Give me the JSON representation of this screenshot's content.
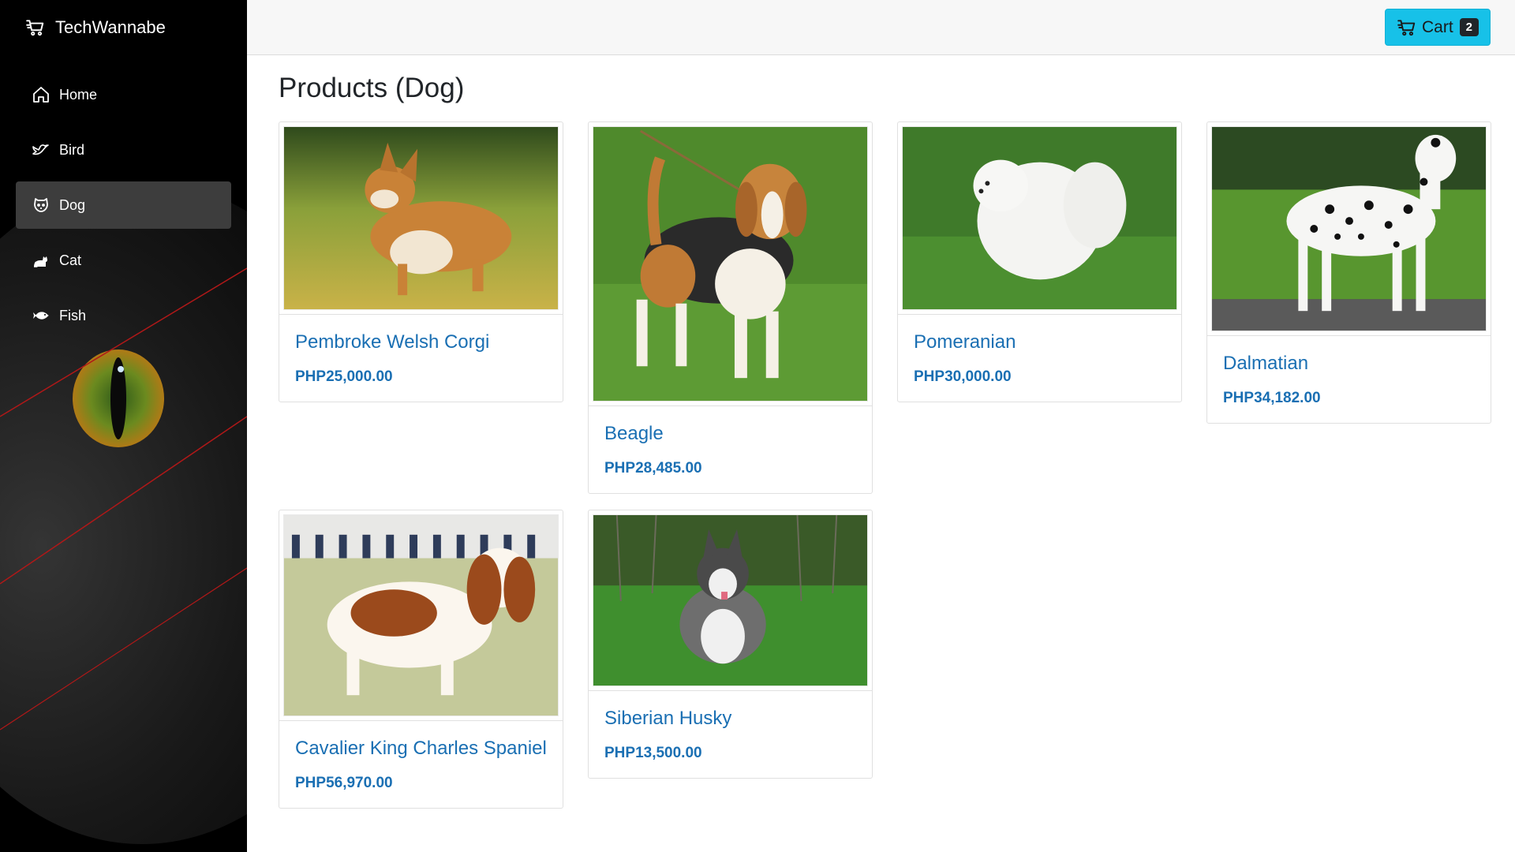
{
  "app": {
    "brand": "TechWannabe"
  },
  "sidebar": {
    "items": [
      {
        "label": "Home",
        "icon": "home-icon",
        "active": false
      },
      {
        "label": "Bird",
        "icon": "bird-icon",
        "active": false
      },
      {
        "label": "Dog",
        "icon": "dog-icon",
        "active": true
      },
      {
        "label": "Cat",
        "icon": "cat-icon",
        "active": false
      },
      {
        "label": "Fish",
        "icon": "fish-icon",
        "active": false
      }
    ]
  },
  "header": {
    "cart_label": "Cart",
    "cart_count": "2",
    "accent_color": "#17c1e8"
  },
  "main": {
    "title": "Products (Dog)",
    "link_color": "#1a6fb3",
    "products": [
      {
        "name": "Pembroke Welsh Corgi",
        "price": "PHP25,000.00",
        "image": "corgi-photo"
      },
      {
        "name": "Beagle",
        "price": "PHP28,485.00",
        "image": "beagle-photo"
      },
      {
        "name": "Pomeranian",
        "price": "PHP30,000.00",
        "image": "pomeranian-photo"
      },
      {
        "name": "Dalmatian",
        "price": "PHP34,182.00",
        "image": "dalmatian-photo"
      },
      {
        "name": "Cavalier King Charles Spaniel",
        "price": "PHP56,970.00",
        "image": "cavalier-photo"
      },
      {
        "name": "Siberian Husky",
        "price": "PHP13,500.00",
        "image": "husky-photo"
      }
    ]
  }
}
